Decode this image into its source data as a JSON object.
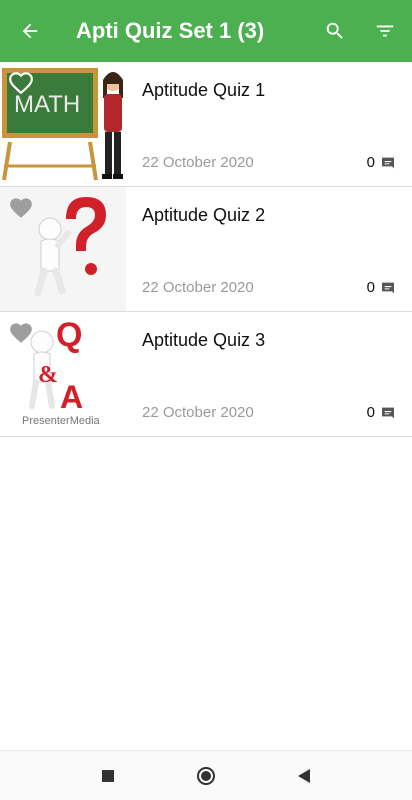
{
  "appbar": {
    "title": "Apti Quiz Set 1 (3)",
    "color": "#4caf50"
  },
  "icons": {
    "back": "arrow-back-icon",
    "search": "search-icon",
    "filter": "filter-icon",
    "heart": "heart-icon",
    "comment": "comment-icon"
  },
  "quizzes": [
    {
      "title": "Aptitude Quiz 1",
      "date": "22 October 2020",
      "comments": "0",
      "thumb_text": "MATH"
    },
    {
      "title": "Aptitude Quiz 2",
      "date": "22 October 2020",
      "comments": "0"
    },
    {
      "title": "Aptitude Quiz 3",
      "date": "22 October 2020",
      "comments": "0",
      "thumb_text": "PresenterMedia"
    }
  ],
  "navbar": [
    "recent-apps-button",
    "home-button",
    "back-nav-button"
  ]
}
